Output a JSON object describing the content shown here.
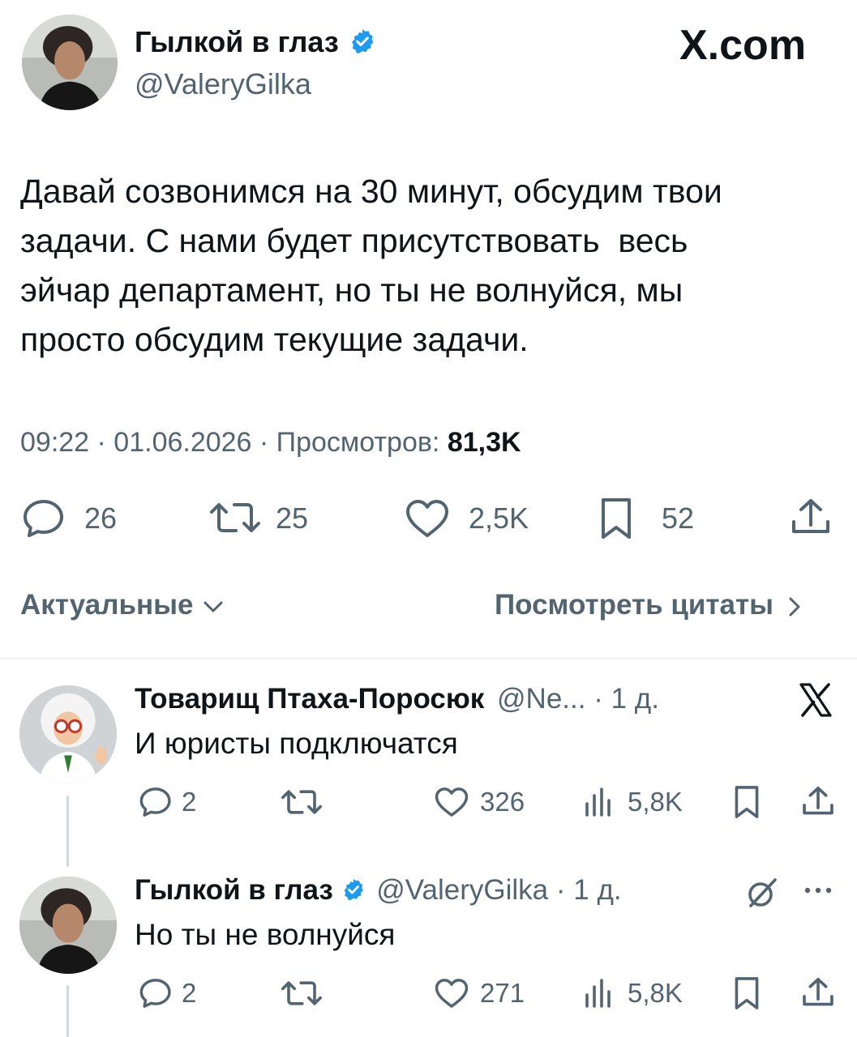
{
  "main_tweet": {
    "author_name": "Гылкой в глаз",
    "author_handle": "@ValeryGilka",
    "site_logo": "X.com",
    "text_lines": [
      "Давай созвонимся на 30 минут, обсудим твои",
      "задачи. С нами будет присутствовать  весь",
      "эйчар департамент, но ты не волнуйся, мы",
      "просто обсудим текущие задачи."
    ],
    "meta_prefix": "09:22 · 01.06.2026 · Просмотров: ",
    "views": "81,3K",
    "stats": {
      "replies": "26",
      "retweets": "25",
      "likes": "2,5K",
      "bookmarks": "52"
    },
    "sort_label": "Актуальные",
    "quotes_label": "Посмотреть цитаты"
  },
  "replies": [
    {
      "author_name": "Товарищ Птаха-Поросюк",
      "author_handle": "@Ne...",
      "time": "· 1 д.",
      "text": "И юристы подключатся",
      "stats": {
        "replies": "2",
        "retweets": "",
        "likes": "326",
        "views": "5,8K"
      }
    },
    {
      "author_name": "Гылкой в глаз",
      "author_handle": "@ValeryGilka",
      "time": "· 1 д.",
      "text": "Но ты не волнуйся",
      "stats": {
        "replies": "2",
        "retweets": "",
        "likes": "271",
        "views": "5,8K"
      }
    }
  ],
  "colors": {
    "verified": "#1d9bf0",
    "text": "#0f1419",
    "muted": "#536471"
  }
}
